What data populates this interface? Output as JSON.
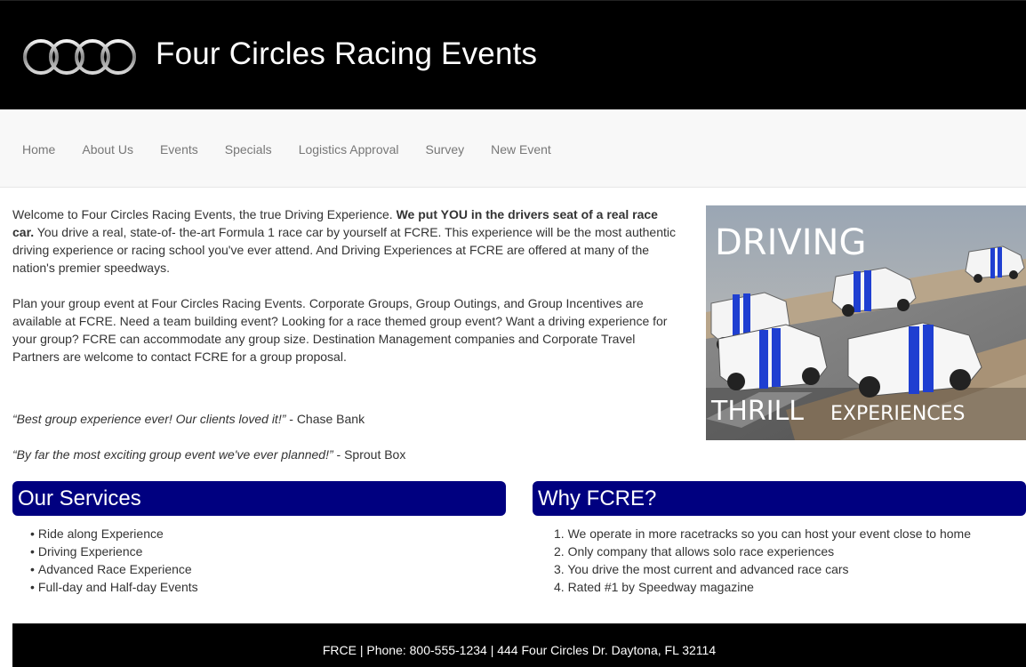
{
  "header": {
    "title": "Four Circles Racing Events",
    "colors": {
      "background": "#000000",
      "title": "#ffffff"
    }
  },
  "nav": {
    "items": [
      "Home",
      "About Us",
      "Events",
      "Specials",
      "Logistics Approval",
      "Survey",
      "New Event"
    ]
  },
  "intro": {
    "p1_start": "Welcome to Four Circles Racing Events, the true Driving Experience. ",
    "p1_bold": "We put YOU in the drivers seat of a real race car.",
    "p1_rest": " You drive a real, state-of- the-art Formula 1 race car by yourself at FCRE. This experience will be the most authentic driving experience or racing school you've ever attend. And Driving Experiences at FCRE are offered at many of the nation's premier speedways.",
    "p2": "Plan your group event at Four Circles Racing Events. Corporate Groups, Group Outings, and Group Incentives are available at FCRE. Need a team building event? Looking for a race themed group event? Want a driving experience for your group? FCRE can accommodate any group size. Destination Management companies and Corporate Travel Partners are welcome to contact FCRE for a group proposal."
  },
  "quotes": [
    {
      "text": "“Best group experience ever! Our clients loved it!”",
      "source": " - Chase Bank"
    },
    {
      "text": "“By far the most exciting group event we've ever planned!”",
      "source": " - Sprout Box"
    }
  ],
  "hero": {
    "top_text": "DRIVING",
    "bottom_text_big": "THRILL",
    "bottom_text_small": "EXPERIENCES"
  },
  "services": {
    "heading": "Our Services",
    "items": [
      "Ride along Experience",
      "Driving Experience",
      "Advanced Race Experience",
      "Full-day and Half-day Events"
    ]
  },
  "why": {
    "heading": "Why FCRE?",
    "items": [
      "1. We operate in more racetracks so you can host your event close to home",
      "2. Only company that allows solo race experiences",
      "3. You drive the most current and advanced race cars",
      "4. Rated #1 by Speedway magazine"
    ]
  },
  "footer": {
    "text": "FRCE | Phone: 800-555-1234 | 444 Four Circles Dr. Daytona, FL 32114"
  },
  "colors": {
    "panel": "#000080",
    "nav_bg": "#f8f8f8",
    "nav_text": "#777777",
    "car_stripe": "#1f3fd1"
  }
}
